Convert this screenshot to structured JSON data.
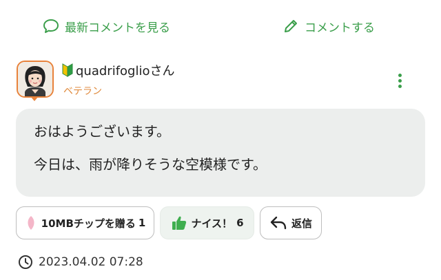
{
  "top": {
    "latest_label": "最新コメントを見る",
    "write_label": "コメントする"
  },
  "comment": {
    "username": "quadrifoglioさん",
    "rank": "ベテラン",
    "lines": [
      "おはようございます。",
      "今日は、雨が降りそうな空模様です。"
    ],
    "tip_label": "10MBチップを贈る",
    "tip_count": "1",
    "nice_label": "ナイス！",
    "nice_count": "6",
    "reply_label": "返信",
    "timestamp": "2023.04.02 07:28"
  },
  "colors": {
    "accent": "#3a9e4a",
    "rank": "#e08a3c",
    "avatar_border": "#e8823a",
    "bubble": "#eceeed"
  },
  "icons": [
    "speech-bubble-icon",
    "pencil-icon",
    "beginner-mark-icon",
    "kebab-menu-icon",
    "petal-icon",
    "thumbs-up-icon",
    "reply-arrow-icon",
    "clock-icon"
  ]
}
